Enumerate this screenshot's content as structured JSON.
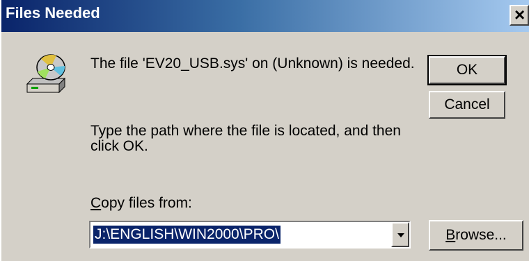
{
  "window": {
    "title": "Files Needed"
  },
  "icons": {
    "close": "close-icon",
    "disk": "cd-drive-icon",
    "dropdown": "chevron-down-icon"
  },
  "colors": {
    "titlebar_start": "#0a246a",
    "titlebar_end": "#a6caf0",
    "face": "#d4d0c8",
    "selection": "#0a246a"
  },
  "message": {
    "line1": "The file 'EV20_USB.sys' on (Unknown) is needed.",
    "line2": "Type the path where the file is located, and then click OK."
  },
  "copy_from": {
    "label_accel": "C",
    "label_rest": "opy files from:",
    "value": "J:\\ENGLISH\\WIN2000\\PRO\\"
  },
  "buttons": {
    "ok": "OK",
    "cancel": "Cancel",
    "browse_accel": "B",
    "browse_rest": "rowse..."
  }
}
